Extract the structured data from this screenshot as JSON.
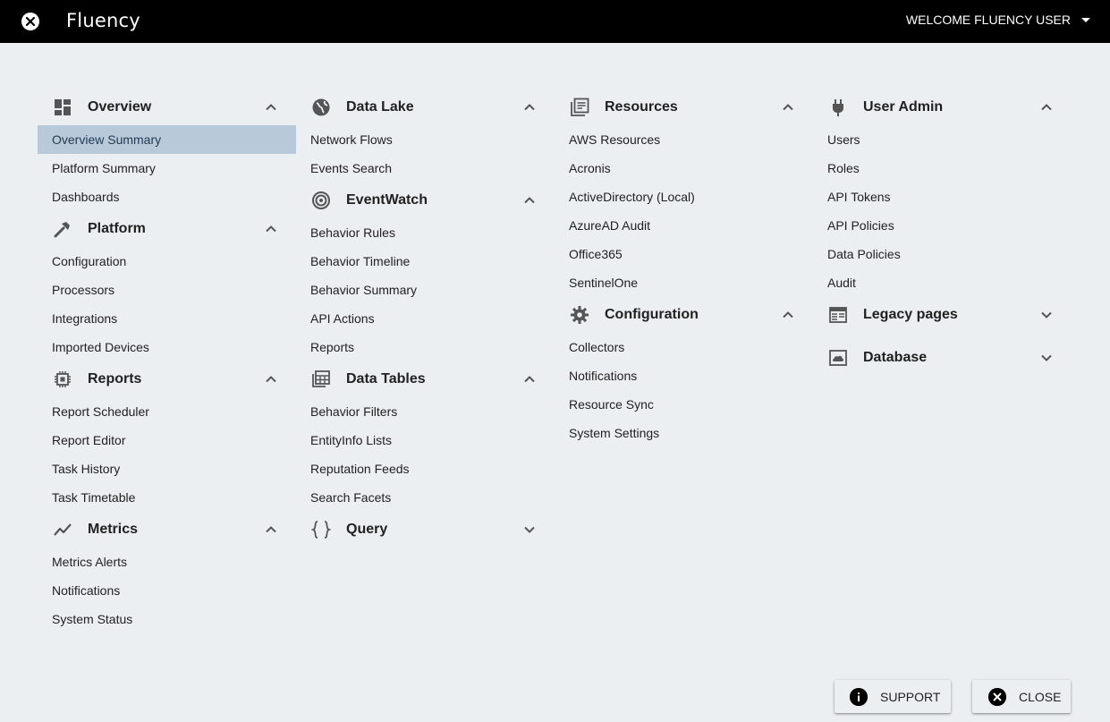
{
  "header": {
    "app_title": "Fluency",
    "welcome_label": "WELCOME FLUENCY USER"
  },
  "colors": {
    "topbar": "#000000",
    "background": "#eceff1",
    "active_item": "#b8cad9"
  },
  "columns": [
    {
      "sections": [
        {
          "title": "Overview",
          "icon": "dashboard-icon",
          "expanded": true,
          "items": [
            "Overview Summary",
            "Platform Summary",
            "Dashboards"
          ],
          "active_index": 0
        },
        {
          "title": "Platform",
          "icon": "hammer-icon",
          "expanded": true,
          "items": [
            "Configuration",
            "Processors",
            "Integrations",
            "Imported Devices"
          ]
        },
        {
          "title": "Reports",
          "icon": "chip-icon",
          "expanded": true,
          "items": [
            "Report Scheduler",
            "Report Editor",
            "Task History",
            "Task Timetable"
          ]
        },
        {
          "title": "Metrics",
          "icon": "trend-icon",
          "expanded": true,
          "items": [
            "Metrics Alerts",
            "Notifications",
            "System Status"
          ]
        }
      ]
    },
    {
      "sections": [
        {
          "title": "Data Lake",
          "icon": "globe-icon",
          "expanded": true,
          "items": [
            "Network Flows",
            "Events Search"
          ]
        },
        {
          "title": "EventWatch",
          "icon": "target-icon",
          "expanded": true,
          "items": [
            "Behavior Rules",
            "Behavior Timeline",
            "Behavior Summary",
            "API Actions",
            "Reports"
          ]
        },
        {
          "title": "Data Tables",
          "icon": "table-icon",
          "expanded": true,
          "items": [
            "Behavior Filters",
            "EntityInfo Lists",
            "Reputation Feeds",
            "Search Facets"
          ]
        },
        {
          "title": "Query",
          "icon": "braces-icon",
          "expanded": false,
          "items": []
        }
      ]
    },
    {
      "sections": [
        {
          "title": "Resources",
          "icon": "library-icon",
          "expanded": true,
          "items": [
            "AWS Resources",
            "Acronis",
            "ActiveDirectory (Local)",
            "AzureAD Audit",
            "Office365",
            "SentinelOne"
          ]
        },
        {
          "title": "Configuration",
          "icon": "gear-icon",
          "expanded": true,
          "items": [
            "Collectors",
            "Notifications",
            "Resource Sync",
            "System Settings"
          ]
        }
      ]
    },
    {
      "sections": [
        {
          "title": "User Admin",
          "icon": "plug-icon",
          "expanded": true,
          "items": [
            "Users",
            "Roles",
            "API Tokens",
            "API Policies",
            "Data Policies",
            "Audit"
          ]
        },
        {
          "title": "Legacy pages",
          "icon": "calendar-view-icon",
          "expanded": false,
          "items": []
        },
        {
          "title": "Database",
          "icon": "cloud-box-icon",
          "expanded": false,
          "items": []
        }
      ]
    }
  ],
  "footer": {
    "support_label": "SUPPORT",
    "close_label": "CLOSE"
  }
}
